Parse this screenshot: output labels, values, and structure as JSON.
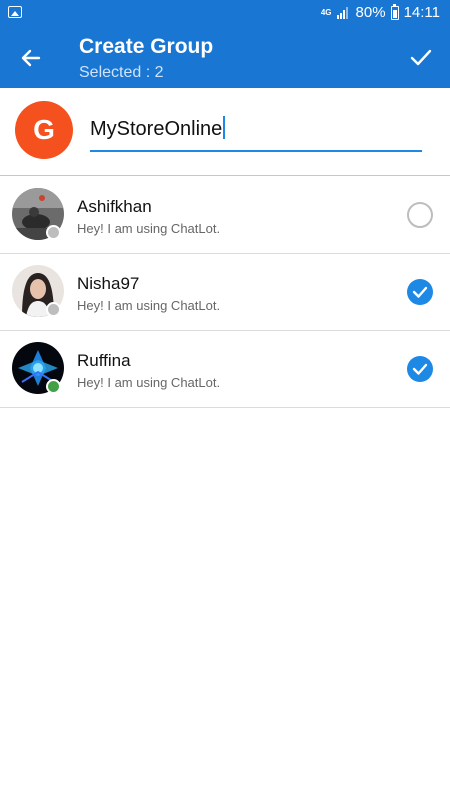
{
  "status_bar": {
    "network": "4G",
    "battery": "80%",
    "time": "14:11"
  },
  "app_bar": {
    "title": "Create Group",
    "subtitle": "Selected : 2"
  },
  "group": {
    "avatar_letter": "G",
    "name_value": "MyStoreOnline"
  },
  "contacts": [
    {
      "name": "Ashifkhan",
      "status": "Hey! I am using ChatLot.",
      "selected": false,
      "online": false
    },
    {
      "name": "Nisha97",
      "status": "Hey! I am using ChatLot.",
      "selected": true,
      "online": false
    },
    {
      "name": "Ruffina",
      "status": "Hey! I am using ChatLot.",
      "selected": true,
      "online": true
    }
  ],
  "colors": {
    "primary": "#1976d2",
    "accent": "#1e88e5",
    "avatar_bg": "#f4511e",
    "online": "#43a047",
    "offline": "#bdbdbd"
  },
  "icons": {
    "back": "arrow-left-icon",
    "done": "check-icon",
    "selected": "check-circle-icon",
    "unselected": "empty-circle-icon"
  }
}
